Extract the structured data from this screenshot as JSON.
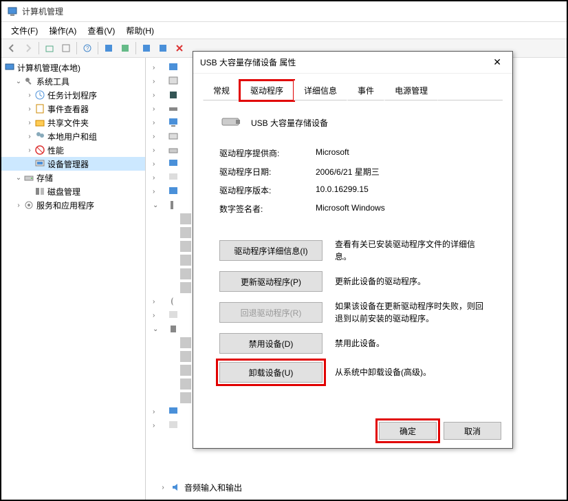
{
  "window": {
    "title": "计算机管理"
  },
  "menu": {
    "file": "文件(F)",
    "action": "操作(A)",
    "view": "查看(V)",
    "help": "帮助(H)"
  },
  "tree": {
    "root": "计算机管理(本地)",
    "sys_tools": "系统工具",
    "task_sched": "任务计划程序",
    "event_viewer": "事件查看器",
    "shared": "共享文件夹",
    "local_users": "本地用户和组",
    "perf": "性能",
    "dev_mgr": "设备管理器",
    "storage": "存储",
    "disk_mgmt": "磁盘管理",
    "services": "服务和应用程序"
  },
  "bottom_device": "音频输入和输出",
  "dialog": {
    "title": "USB 大容量存储设备 属性",
    "tabs": {
      "general": "常规",
      "driver": "驱动程序",
      "details": "详细信息",
      "events": "事件",
      "power": "电源管理"
    },
    "device_name": "USB 大容量存储设备",
    "provider_label": "驱动程序提供商:",
    "provider_value": "Microsoft",
    "date_label": "驱动程序日期:",
    "date_value": "2006/6/21 星期三",
    "version_label": "驱动程序版本:",
    "version_value": "10.0.16299.15",
    "signer_label": "数字签名者:",
    "signer_value": "Microsoft Windows",
    "btn_details": "驱动程序详细信息(I)",
    "desc_details": "查看有关已安装驱动程序文件的详细信息。",
    "btn_update": "更新驱动程序(P)",
    "desc_update": "更新此设备的驱动程序。",
    "btn_rollback": "回退驱动程序(R)",
    "desc_rollback": "如果该设备在更新驱动程序时失败，则回退到以前安装的驱动程序。",
    "btn_disable": "禁用设备(D)",
    "desc_disable": "禁用此设备。",
    "btn_uninstall": "卸载设备(U)",
    "desc_uninstall": "从系统中卸载设备(高级)。",
    "ok": "确定",
    "cancel": "取消"
  }
}
